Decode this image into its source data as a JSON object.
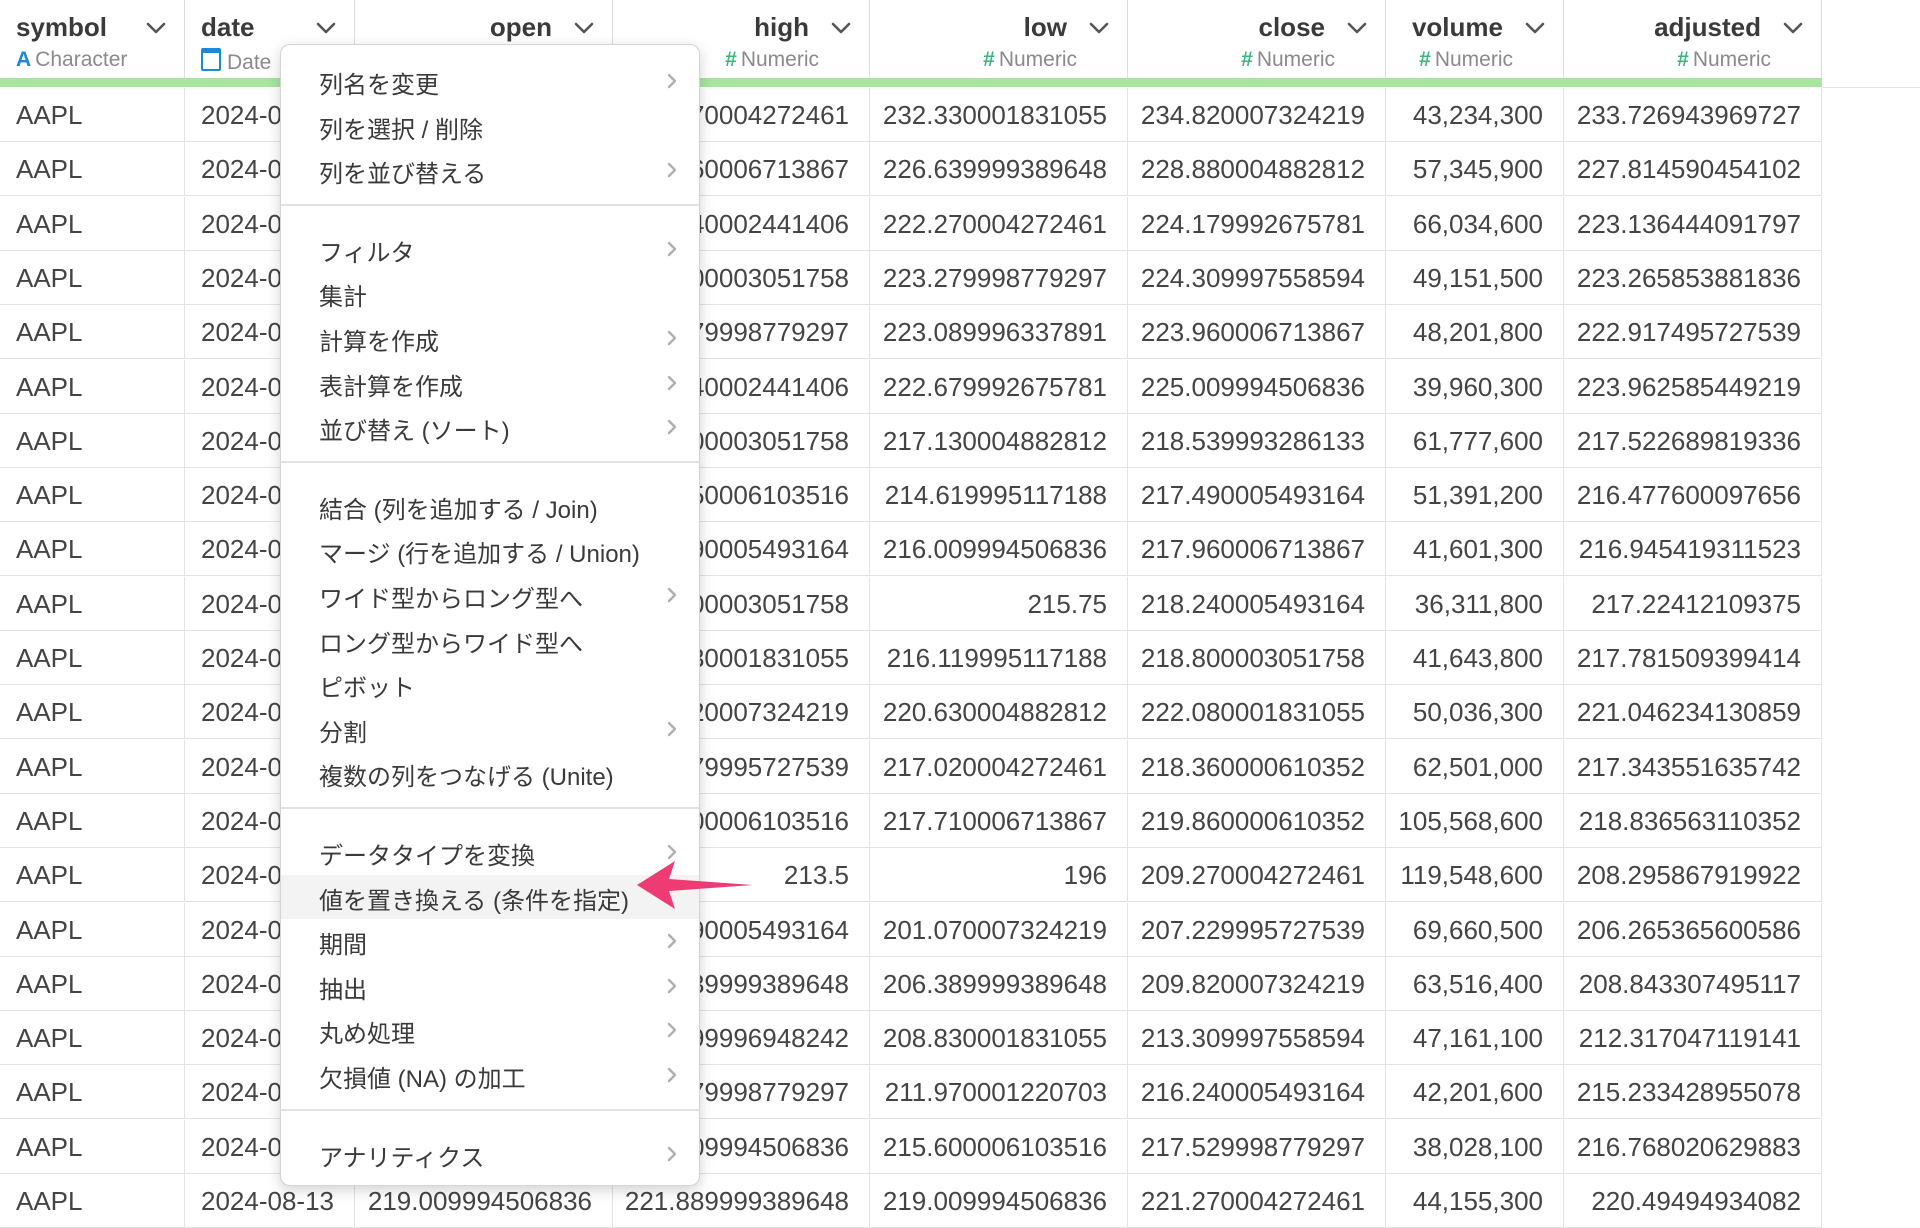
{
  "columns": [
    {
      "name": "symbol",
      "type": "Character",
      "type_icon": "character-type-icon",
      "align": "left"
    },
    {
      "name": "date",
      "type": "Date",
      "type_icon": "calendar-icon",
      "align": "left"
    },
    {
      "name": "open",
      "type": "",
      "type_icon": "",
      "align": "right"
    },
    {
      "name": "high",
      "type": "Numeric",
      "type_icon": "numeric-type-icon",
      "align": "right"
    },
    {
      "name": "low",
      "type": "Numeric",
      "type_icon": "numeric-type-icon",
      "align": "right"
    },
    {
      "name": "close",
      "type": "Numeric",
      "type_icon": "numeric-type-icon",
      "align": "right"
    },
    {
      "name": "volume",
      "type": "Numeric",
      "type_icon": "numeric-type-icon",
      "align": "right"
    },
    {
      "name": "adjusted",
      "type": "Numeric",
      "type_icon": "numeric-type-icon",
      "align": "right"
    }
  ],
  "rows": [
    [
      "AAPL",
      "2024-0",
      "",
      "70004272461",
      "232.330001831055",
      "234.820007324219",
      "43,234,300",
      "233.726943969727"
    ],
    [
      "AAPL",
      "2024-0",
      "",
      "60006713867",
      "226.639999389648",
      "228.880004882812",
      "57,345,900",
      "227.814590454102"
    ],
    [
      "AAPL",
      "2024-0",
      "",
      "40002441406",
      "222.270004272461",
      "224.179992675781",
      "66,034,600",
      "223.136444091797"
    ],
    [
      "AAPL",
      "2024-0",
      "",
      "00003051758",
      "223.279998779297",
      "224.309997558594",
      "49,151,500",
      "223.265853881836"
    ],
    [
      "AAPL",
      "2024-0",
      "",
      "79998779297",
      "223.089996337891",
      "223.960006713867",
      "48,201,800",
      "222.917495727539"
    ],
    [
      "AAPL",
      "2024-0",
      "",
      "40002441406",
      "222.679992675781",
      "225.009994506836",
      "39,960,300",
      "223.962585449219"
    ],
    [
      "AAPL",
      "2024-0",
      "",
      "00003051758",
      "217.130004882812",
      "218.539993286133",
      "61,777,600",
      "217.522689819336"
    ],
    [
      "AAPL",
      "2024-0",
      "",
      "50006103516",
      "214.619995117188",
      "217.490005493164",
      "51,391,200",
      "216.477600097656"
    ],
    [
      "AAPL",
      "2024-0",
      "",
      "90005493164",
      "216.009994506836",
      "217.960006713867",
      "41,601,300",
      "216.945419311523"
    ],
    [
      "AAPL",
      "2024-0",
      "",
      "00003051758",
      "215.75",
      "218.240005493164",
      "36,311,800",
      "217.22412109375"
    ],
    [
      "AAPL",
      "2024-0",
      "",
      "30001831055",
      "216.119995117188",
      "218.800003051758",
      "41,643,800",
      "217.781509399414"
    ],
    [
      "AAPL",
      "2024-0",
      "",
      "20007324219",
      "220.630004882812",
      "222.080001831055",
      "50,036,300",
      "221.046234130859"
    ],
    [
      "AAPL",
      "2024-0",
      "",
      "79995727539",
      "217.020004272461",
      "218.360000610352",
      "62,501,000",
      "217.343551635742"
    ],
    [
      "AAPL",
      "2024-0",
      "",
      "00006103516",
      "217.710006713867",
      "219.860000610352",
      "105,568,600",
      "218.836563110352"
    ],
    [
      "AAPL",
      "2024-0",
      "",
      "213.5",
      "196",
      "209.270004272461",
      "119,548,600",
      "208.295867919922"
    ],
    [
      "AAPL",
      "2024-0",
      "",
      "90005493164",
      "201.070007324219",
      "207.229995727539",
      "69,660,500",
      "206.265365600586"
    ],
    [
      "AAPL",
      "2024-0",
      "",
      "39999389648",
      "206.389999389648",
      "209.820007324219",
      "63,516,400",
      "208.843307495117"
    ],
    [
      "AAPL",
      "2024-0",
      "",
      "99996948242",
      "208.830001831055",
      "213.309997558594",
      "47,161,100",
      "212.317047119141"
    ],
    [
      "AAPL",
      "2024-0",
      "",
      "79998779297",
      "211.970001220703",
      "216.240005493164",
      "42,201,600",
      "215.233428955078"
    ],
    [
      "AAPL",
      "2024-0",
      "",
      "09994506836",
      "215.600006103516",
      "217.529998779297",
      "38,028,100",
      "216.768020629883"
    ],
    [
      "AAPL",
      "2024-08-13",
      "219.009994506836",
      "221.889999389648",
      "219.009994506836",
      "221.270004272461",
      "44,155,300",
      "220.49494934082"
    ]
  ],
  "menu": {
    "items": [
      {
        "label": "列名を変更",
        "submenu": true,
        "name": "menu-rename-column",
        "sep_before": false,
        "highlighted": false
      },
      {
        "label": "列を選択 / 削除",
        "submenu": false,
        "name": "menu-select-remove-columns",
        "sep_before": false,
        "highlighted": false
      },
      {
        "label": "列を並び替える",
        "submenu": true,
        "name": "menu-reorder-columns",
        "sep_before": false,
        "highlighted": false
      },
      {
        "label": "フィルタ",
        "submenu": true,
        "name": "menu-filter",
        "sep_before": true,
        "highlighted": false
      },
      {
        "label": "集計",
        "submenu": false,
        "name": "menu-summarize",
        "sep_before": false,
        "highlighted": false
      },
      {
        "label": "計算を作成",
        "submenu": true,
        "name": "menu-create-calculation",
        "sep_before": false,
        "highlighted": false
      },
      {
        "label": "表計算を作成",
        "submenu": true,
        "name": "menu-create-window-calculation",
        "sep_before": false,
        "highlighted": false
      },
      {
        "label": "並び替え (ソート)",
        "submenu": true,
        "name": "menu-sort",
        "sep_before": false,
        "highlighted": false
      },
      {
        "label": "結合 (列を追加する / Join)",
        "submenu": false,
        "name": "menu-join",
        "sep_before": true,
        "highlighted": false
      },
      {
        "label": "マージ (行を追加する / Union)",
        "submenu": false,
        "name": "menu-union",
        "sep_before": false,
        "highlighted": false
      },
      {
        "label": "ワイド型からロング型へ",
        "submenu": true,
        "name": "menu-wide-to-long",
        "sep_before": false,
        "highlighted": false
      },
      {
        "label": "ロング型からワイド型へ",
        "submenu": false,
        "name": "menu-long-to-wide",
        "sep_before": false,
        "highlighted": false
      },
      {
        "label": "ピボット",
        "submenu": false,
        "name": "menu-pivot",
        "sep_before": false,
        "highlighted": false
      },
      {
        "label": "分割",
        "submenu": true,
        "name": "menu-separate",
        "sep_before": false,
        "highlighted": false
      },
      {
        "label": "複数の列をつなげる (Unite)",
        "submenu": false,
        "name": "menu-unite",
        "sep_before": false,
        "highlighted": false
      },
      {
        "label": "データタイプを変換",
        "submenu": true,
        "name": "menu-convert-data-type",
        "sep_before": true,
        "highlighted": false
      },
      {
        "label": "値を置き換える (条件を指定)",
        "submenu": false,
        "name": "menu-replace-values-conditional",
        "sep_before": false,
        "highlighted": true
      },
      {
        "label": "期間",
        "submenu": true,
        "name": "menu-period",
        "sep_before": false,
        "highlighted": false
      },
      {
        "label": "抽出",
        "submenu": true,
        "name": "menu-extract",
        "sep_before": false,
        "highlighted": false
      },
      {
        "label": "丸め処理",
        "submenu": true,
        "name": "menu-rounding",
        "sep_before": false,
        "highlighted": false
      },
      {
        "label": "欠損値 (NA) の加工",
        "submenu": true,
        "name": "menu-na-handling",
        "sep_before": false,
        "highlighted": false
      },
      {
        "label": "アナリティクス",
        "submenu": true,
        "name": "menu-analytics",
        "sep_before": true,
        "highlighted": false
      }
    ]
  },
  "colors": {
    "green_bar": "#a8e6a0",
    "numeric_icon": "#3fb47c",
    "character_icon": "#1e88d8",
    "arrow": "#ef3b73"
  }
}
